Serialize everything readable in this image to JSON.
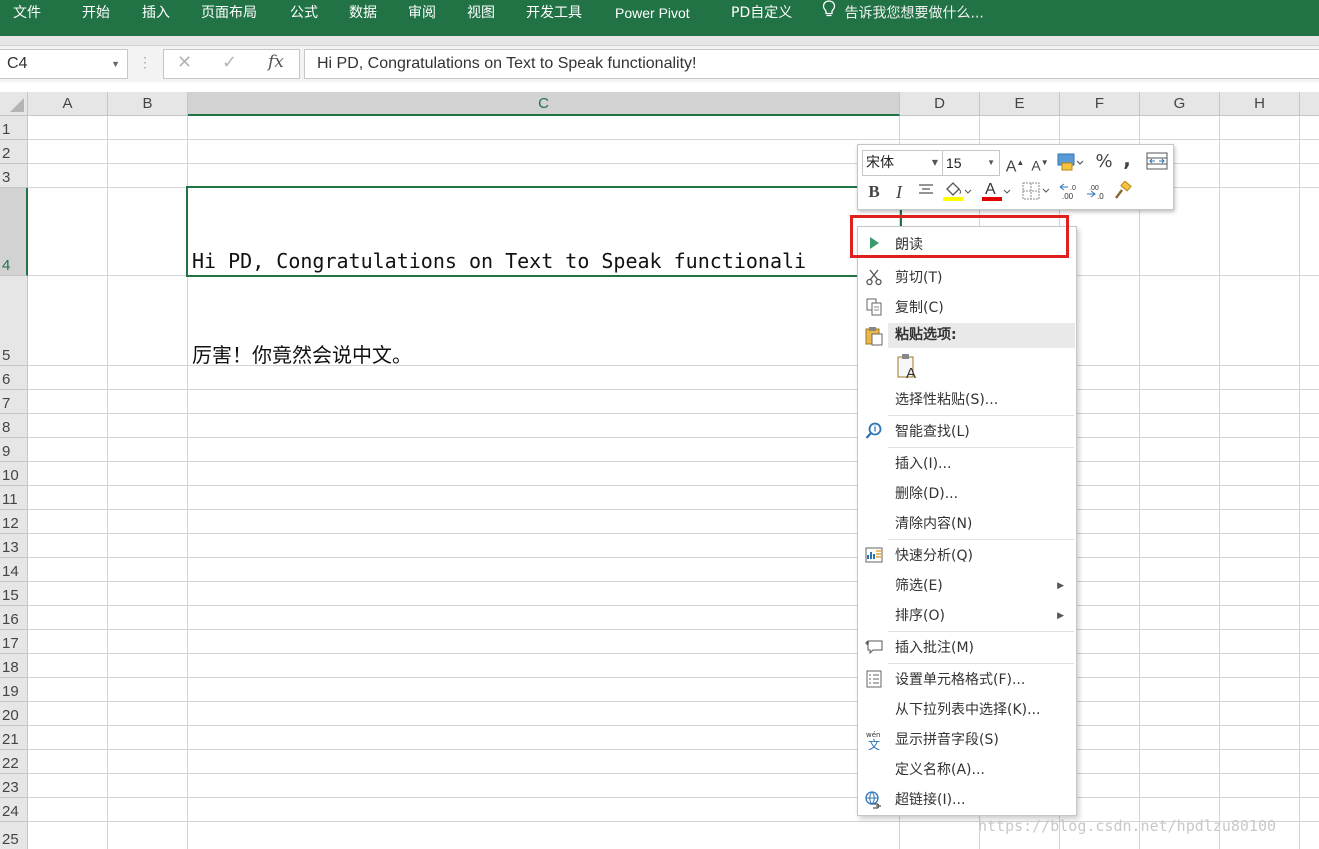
{
  "ribbon": {
    "tabs": [
      "文件",
      "开始",
      "插入",
      "页面布局",
      "公式",
      "数据",
      "审阅",
      "视图",
      "开发工具",
      "Power Pivot",
      "PD自定义"
    ],
    "tell_me": "告诉我您想要做什么...",
    "color": "#217346"
  },
  "formula_bar": {
    "name_box": "C4",
    "cancel_icon": "✕",
    "enter_icon": "✓",
    "fx_label": "fx",
    "content": "Hi PD, Congratulations on Text to Speak functionality!"
  },
  "sheet": {
    "columns": [
      "A",
      "B",
      "C",
      "D",
      "E",
      "F",
      "G",
      "H"
    ],
    "selected_column": "C",
    "rows": [
      "1",
      "2",
      "3",
      "4",
      "5",
      "6",
      "7",
      "8",
      "9",
      "10",
      "11",
      "12",
      "13",
      "14",
      "15",
      "16",
      "17",
      "18",
      "19",
      "20",
      "21",
      "22",
      "23",
      "24",
      "25"
    ],
    "selected_row": "4",
    "cells": {
      "C4": "Hi PD, Congratulations on Text to Speak functionali",
      "C5": "厉害！你竟然会说中文。"
    }
  },
  "mini_toolbar": {
    "font": "宋体",
    "size": "15",
    "bold": "B",
    "italic": "I",
    "percent": "%",
    "comma": ","
  },
  "context_menu": {
    "items": [
      {
        "label": "朗读",
        "icon": "play-icon"
      },
      {
        "label": "剪切(T)",
        "icon": "scissors-icon"
      },
      {
        "label": "复制(C)",
        "icon": "copy-icon"
      },
      {
        "label": "粘贴选项:",
        "icon": "clipboard-icon"
      },
      {
        "label": "选择性粘贴(S)...",
        "icon": ""
      },
      {
        "label": "智能查找(L)",
        "icon": "search-icon"
      },
      {
        "label": "插入(I)...",
        "icon": ""
      },
      {
        "label": "删除(D)...",
        "icon": ""
      },
      {
        "label": "清除内容(N)",
        "icon": ""
      },
      {
        "label": "快速分析(Q)",
        "icon": "quick-analysis-icon"
      },
      {
        "label": "筛选(E)",
        "icon": ""
      },
      {
        "label": "排序(O)",
        "icon": ""
      },
      {
        "label": "插入批注(M)",
        "icon": "comment-icon"
      },
      {
        "label": "设置单元格格式(F)...",
        "icon": "format-cells-icon"
      },
      {
        "label": "从下拉列表中选择(K)...",
        "icon": ""
      },
      {
        "label": "显示拼音字段(S)",
        "icon": "phonetic-icon"
      },
      {
        "label": "定义名称(A)...",
        "icon": ""
      },
      {
        "label": "超链接(I)...",
        "icon": "hyperlink-icon"
      }
    ],
    "highlight_color": "#e0201c"
  },
  "watermark": "https://blog.csdn.net/hpdlzu80100"
}
